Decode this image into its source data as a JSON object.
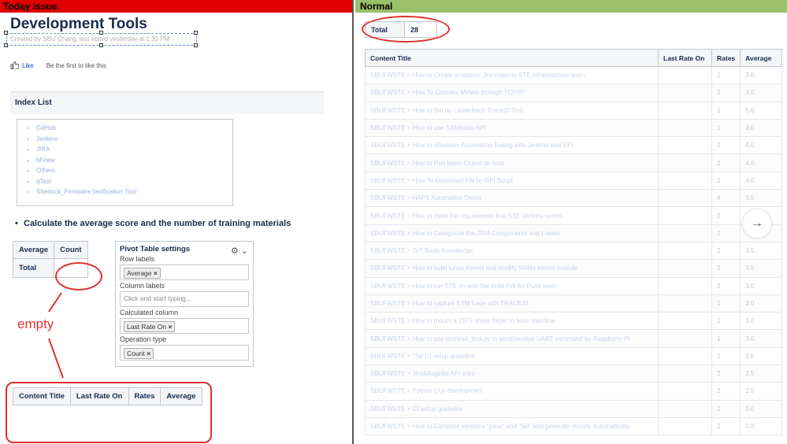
{
  "left_header": "Today issue.",
  "right_header": "Normal",
  "page": {
    "title": "Development Tools",
    "byline": "Created by SBU Chang, last edited yesterday at 1:33 PM",
    "like_label": "Like",
    "like_note": "Be the first to like this"
  },
  "index_list": {
    "title": "Index List",
    "items": [
      "GitHub",
      "Jenkins",
      "JIRA",
      "MView",
      "Others",
      "qTest",
      "Sherlock_Firmware Verification Tool"
    ]
  },
  "bullet_heading": "Calculate the average score and the number of training materials",
  "pivot_small": {
    "headers": [
      "Average",
      "Count"
    ],
    "row_label": "Total"
  },
  "pivot_settings": {
    "title": "Pivot Table settings",
    "row_labels_label": "Row labels",
    "row_labels_tag": "Average",
    "column_labels_label": "Column labels",
    "column_labels_placeholder": "Click and start typing...",
    "calculated_column_label": "Calculated column",
    "calculated_column_tag": "Last Rate On",
    "operation_type_label": "Operation type",
    "operation_type_tag": "Count"
  },
  "annotation": {
    "empty_label": "empty",
    "color": "#e03030"
  },
  "empty_table": {
    "headers": [
      "Content Title",
      "Last Rate On",
      "Rates",
      "Average"
    ]
  },
  "total": {
    "label": "Total",
    "value": "28"
  },
  "result_table": {
    "headers": [
      "Content Title",
      "Last Rate On",
      "Rates",
      "Average"
    ],
    "rows": [
      {
        "title": "SBUFWSTE > How to Create a request Jira coast to STE infrastructure team",
        "rates": "2",
        "average": "3.0"
      },
      {
        "title": "SBUFWSTE > How To Connect MView through TCP/IP",
        "rates": "2",
        "average": "3.0"
      },
      {
        "title": "SBUFWSTE > How to Set up Lauterbach Trace32 Tool",
        "rates": "1",
        "average": "5.0"
      },
      {
        "title": "SBUFWSTE > How to use SANblade API",
        "rates": "1",
        "average": "3.0"
      },
      {
        "title": "SBUFWSTE > How to Windows Automation Rating with Jenkins and RPi",
        "rates": "2",
        "average": "4.0"
      },
      {
        "title": "SBUFWSTE > How to Run basic CI test on host",
        "rates": "2",
        "average": "4.0"
      },
      {
        "title": "SBUFWSTE > How To Download FW by RPi Script",
        "rates": "1",
        "average": "4.0"
      },
      {
        "title": "SBUFWSTE > HAPS Automation Demo",
        "rates": "4",
        "average": "3.5"
      },
      {
        "title": "SBUFWSTE > How to meet the requirement that STE Jenkins needs",
        "rates": "2",
        "average": ""
      },
      {
        "title": "SBUFWSTE > How to Categorize the JIRA Components and Labels",
        "rates": "2",
        "average": ""
      },
      {
        "title": "SBUFWSTE > GIT Basic Knowledge",
        "rates": "2",
        "average": "3.5"
      },
      {
        "title": "SBUFWSTE > How to build Linux Kernel and modify NVMe kernel module",
        "rates": "2",
        "average": "3.5"
      },
      {
        "title": "SBUFWSTE > How to run STE on with the build FW for Pune team",
        "rates": "2",
        "average": "3.0"
      },
      {
        "title": "SBUFWSTE > How to capture ETM trace with TRACE32",
        "rates": "1",
        "average": "3.0"
      },
      {
        "title": "SBUFWSTE > How to mount a CIFS share folder to linux machine",
        "rates": "1",
        "average": "3.0"
      },
      {
        "title": "SBUFWSTE > How to use terminal_tool.py to send/receive UART command by Raspberry Pi",
        "rates": "1",
        "average": "3.0"
      },
      {
        "title": "SBUFWSTE > The CI setup guideline",
        "rates": "2",
        "average": "2.5"
      },
      {
        "title": "SBUFWSTE > Jira&Bugzilla API Intro",
        "rates": "2",
        "average": "2.5"
      },
      {
        "title": "SBUFWSTE > Python GUI development",
        "rates": "2",
        "average": "2.5"
      },
      {
        "title": "SBUFWSTE > CI setup guideline",
        "rates": "2",
        "average": "2.0"
      },
      {
        "title": "SBUFWSTE > How to Compare versions \"pass\" and \"fail\" and generate reports automatically",
        "rates": "2",
        "average": "2.0"
      }
    ]
  }
}
